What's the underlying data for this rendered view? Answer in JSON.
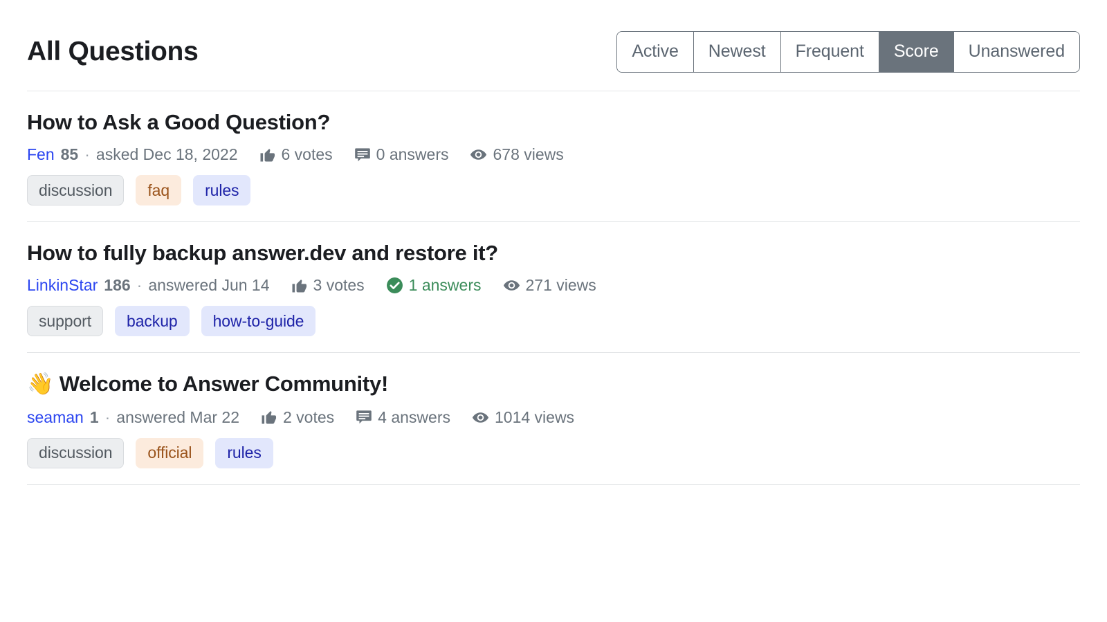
{
  "header": {
    "title": "All Questions",
    "tabs": [
      {
        "label": "Active",
        "active": false
      },
      {
        "label": "Newest",
        "active": false
      },
      {
        "label": "Frequent",
        "active": false
      },
      {
        "label": "Score",
        "active": true
      },
      {
        "label": "Unanswered",
        "active": false
      }
    ]
  },
  "questions": [
    {
      "emoji": "",
      "title": "How to Ask a Good Question?",
      "author": "Fen",
      "reputation": "85",
      "separator": "·",
      "activity": "asked Dec 18, 2022",
      "votes": "6 votes",
      "votes_icon": "thumbs-up-icon",
      "answers": "0 answers",
      "answers_icon": "speech-bubble-icon",
      "answered": false,
      "views": "678 views",
      "views_icon": "eye-icon",
      "tags": [
        {
          "label": "discussion",
          "style": "gray"
        },
        {
          "label": "faq",
          "style": "orange"
        },
        {
          "label": "rules",
          "style": "blue"
        }
      ]
    },
    {
      "emoji": "",
      "title": "How to fully backup answer.dev and restore it?",
      "author": "LinkinStar",
      "reputation": "186",
      "separator": "·",
      "activity": "answered Jun 14",
      "votes": "3 votes",
      "votes_icon": "thumbs-up-icon",
      "answers": "1 answers",
      "answers_icon": "check-circle-icon",
      "answered": true,
      "views": "271 views",
      "views_icon": "eye-icon",
      "tags": [
        {
          "label": "support",
          "style": "gray"
        },
        {
          "label": "backup",
          "style": "blue"
        },
        {
          "label": "how-to-guide",
          "style": "blue"
        }
      ]
    },
    {
      "emoji": "👋",
      "title": "Welcome to Answer Community!",
      "author": "seaman",
      "reputation": "1",
      "separator": "·",
      "activity": "answered Mar 22",
      "votes": "2 votes",
      "votes_icon": "thumbs-up-icon",
      "answers": "4 answers",
      "answers_icon": "speech-bubble-icon",
      "answered": false,
      "views": "1014 views",
      "views_icon": "eye-icon",
      "tags": [
        {
          "label": "discussion",
          "style": "gray"
        },
        {
          "label": "official",
          "style": "orange"
        },
        {
          "label": "rules",
          "style": "blue"
        }
      ]
    }
  ],
  "colors": {
    "accent_link": "#2b45f0",
    "muted_text": "#6a737c",
    "active_tab_bg": "#6a737c",
    "answered_green": "#3b8c5a",
    "tag_gray_bg": "#eceef0",
    "tag_blue_bg": "#e2e7fc",
    "tag_orange_bg": "#fcebdd",
    "divider": "#e3e6e8"
  }
}
